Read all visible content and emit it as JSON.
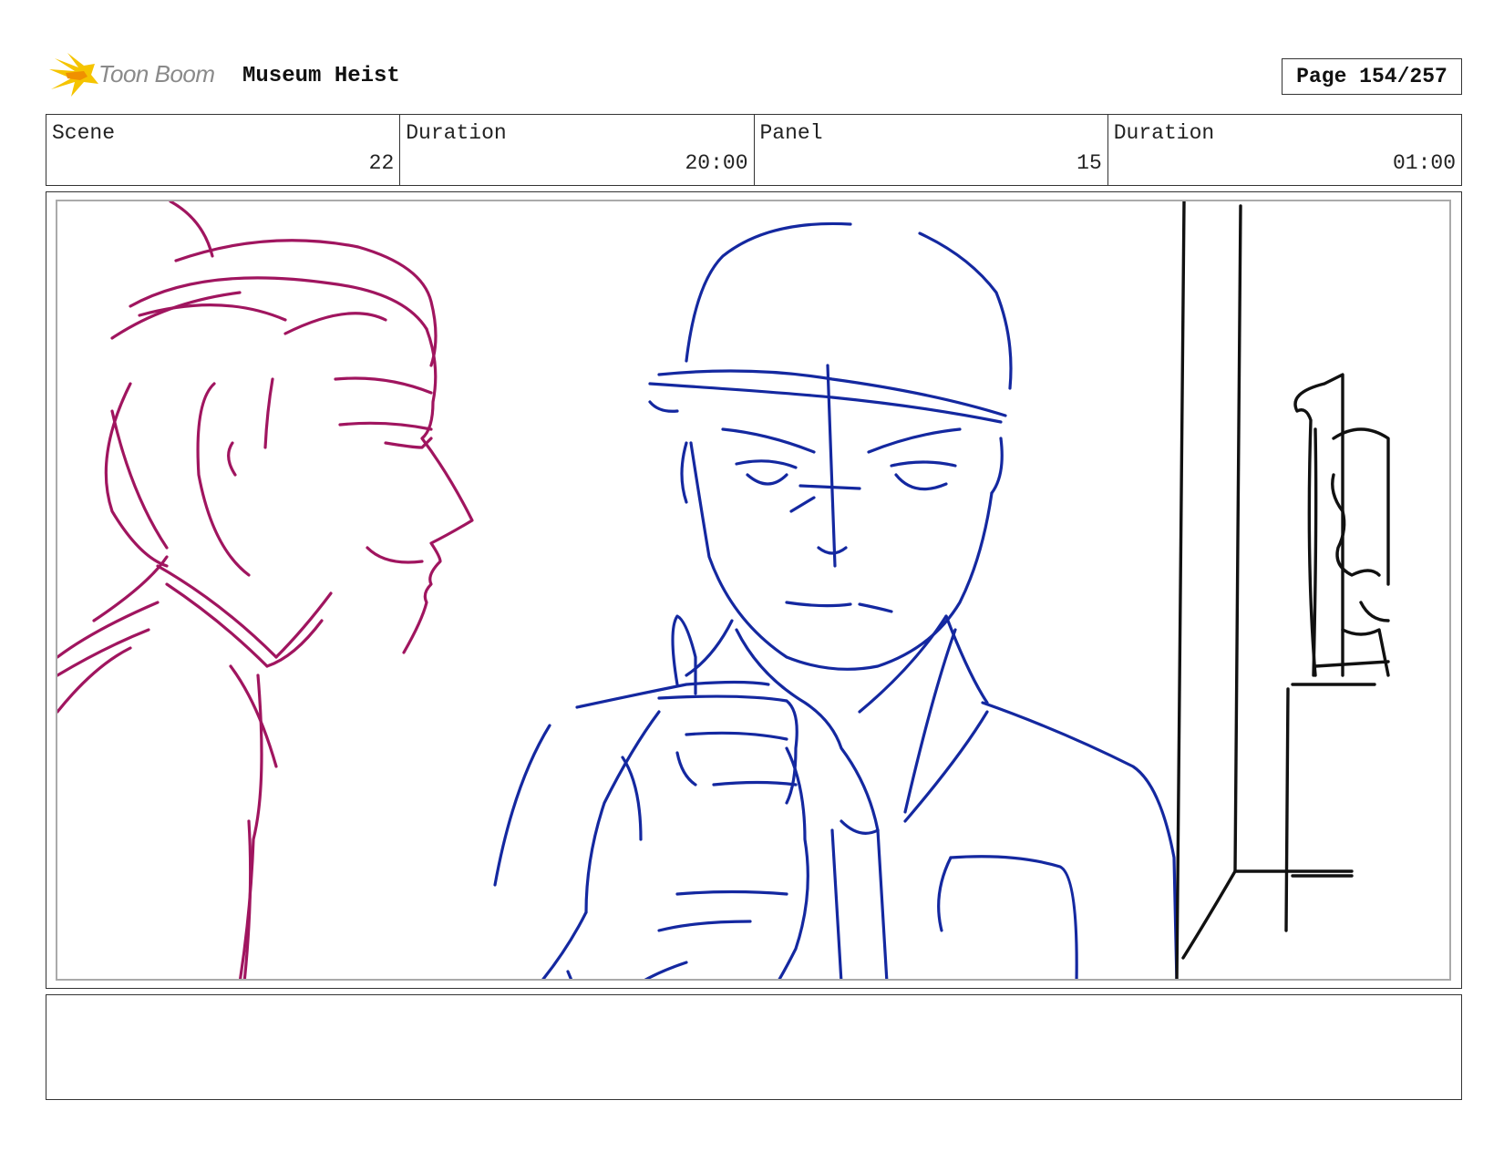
{
  "header": {
    "logo_text": "Toon Boom",
    "project_title": "Museum Heist",
    "page_label": "Page 154/257"
  },
  "info": {
    "scene_label": "Scene",
    "scene_value": "22",
    "scene_duration_label": "Duration",
    "scene_duration_value": "20:00",
    "panel_label": "Panel",
    "panel_value": "15",
    "panel_duration_label": "Duration",
    "panel_duration_value": "01:00"
  },
  "colors": {
    "left_character": "#a0155f",
    "guard": "#1428a0",
    "background": "#111111",
    "logo_flame": "#f5c400"
  },
  "notes": {
    "text": ""
  }
}
